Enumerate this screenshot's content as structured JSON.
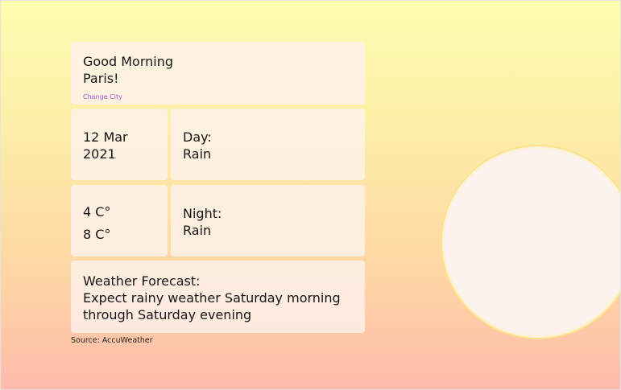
{
  "greeting": {
    "line1": "Good Morning",
    "line2": "Paris!",
    "change_city": "Change City"
  },
  "date": {
    "line1": "12 Mar",
    "line2": "2021"
  },
  "day": {
    "label": "Day:",
    "condition": "Rain"
  },
  "temperature": {
    "low": "4 C°",
    "high": "8 C°"
  },
  "night": {
    "label": "Night:",
    "condition": "Rain"
  },
  "forecast": {
    "label": "Weather Forecast:",
    "text": "Expect rainy weather Saturday morning through Saturday evening"
  },
  "source": "Source: AccuWeather",
  "colors": {
    "background_top": "#fdfdb0",
    "background_bottom": "#febbab",
    "card": "#fdf2ec",
    "link": "#a456d6",
    "sun_ring": "#fde48c"
  }
}
